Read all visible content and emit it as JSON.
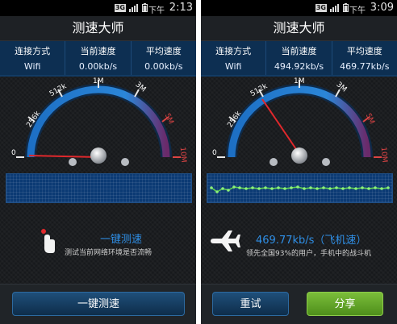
{
  "left": {
    "status": {
      "network": "3G",
      "ampm": "下午",
      "time": "2:13"
    },
    "title": "测速大师",
    "stats": [
      {
        "label": "连接方式",
        "value": "Wifi"
      },
      {
        "label": "当前速度",
        "value": "0.00kb/s"
      },
      {
        "label": "平均速度",
        "value": "0.00kb/s"
      }
    ],
    "gauge": {
      "ticks": [
        "0",
        "256k",
        "512k",
        "1M",
        "3M",
        "5M",
        "10M"
      ],
      "needle_value": "0"
    },
    "result_title": "一键测速",
    "result_sub": "测试当前网络环境是否流畅",
    "button": "一键测速"
  },
  "right": {
    "status": {
      "network": "3G",
      "ampm": "下午",
      "time": "3:09"
    },
    "title": "测速大师",
    "stats": [
      {
        "label": "连接方式",
        "value": "Wifi"
      },
      {
        "label": "当前速度",
        "value": "494.92kb/s"
      },
      {
        "label": "平均速度",
        "value": "469.77kb/s"
      }
    ],
    "gauge": {
      "ticks": [
        "0",
        "256k",
        "512k",
        "1M",
        "3M",
        "5M",
        "10M"
      ],
      "needle_value": "512k"
    },
    "result_title": "469.77kb/s（飞机速）",
    "result_sub": "领先全国93%的用户，手机中的战斗机",
    "buttons": [
      "重试",
      "分享"
    ]
  },
  "colors": {
    "accent_blue": "#2f8fe6",
    "share_green": "#6aaa2c",
    "needle_red": "#e0282c"
  },
  "icons": {
    "tap": "hand-tap-icon",
    "plane": "airplane-icon"
  }
}
